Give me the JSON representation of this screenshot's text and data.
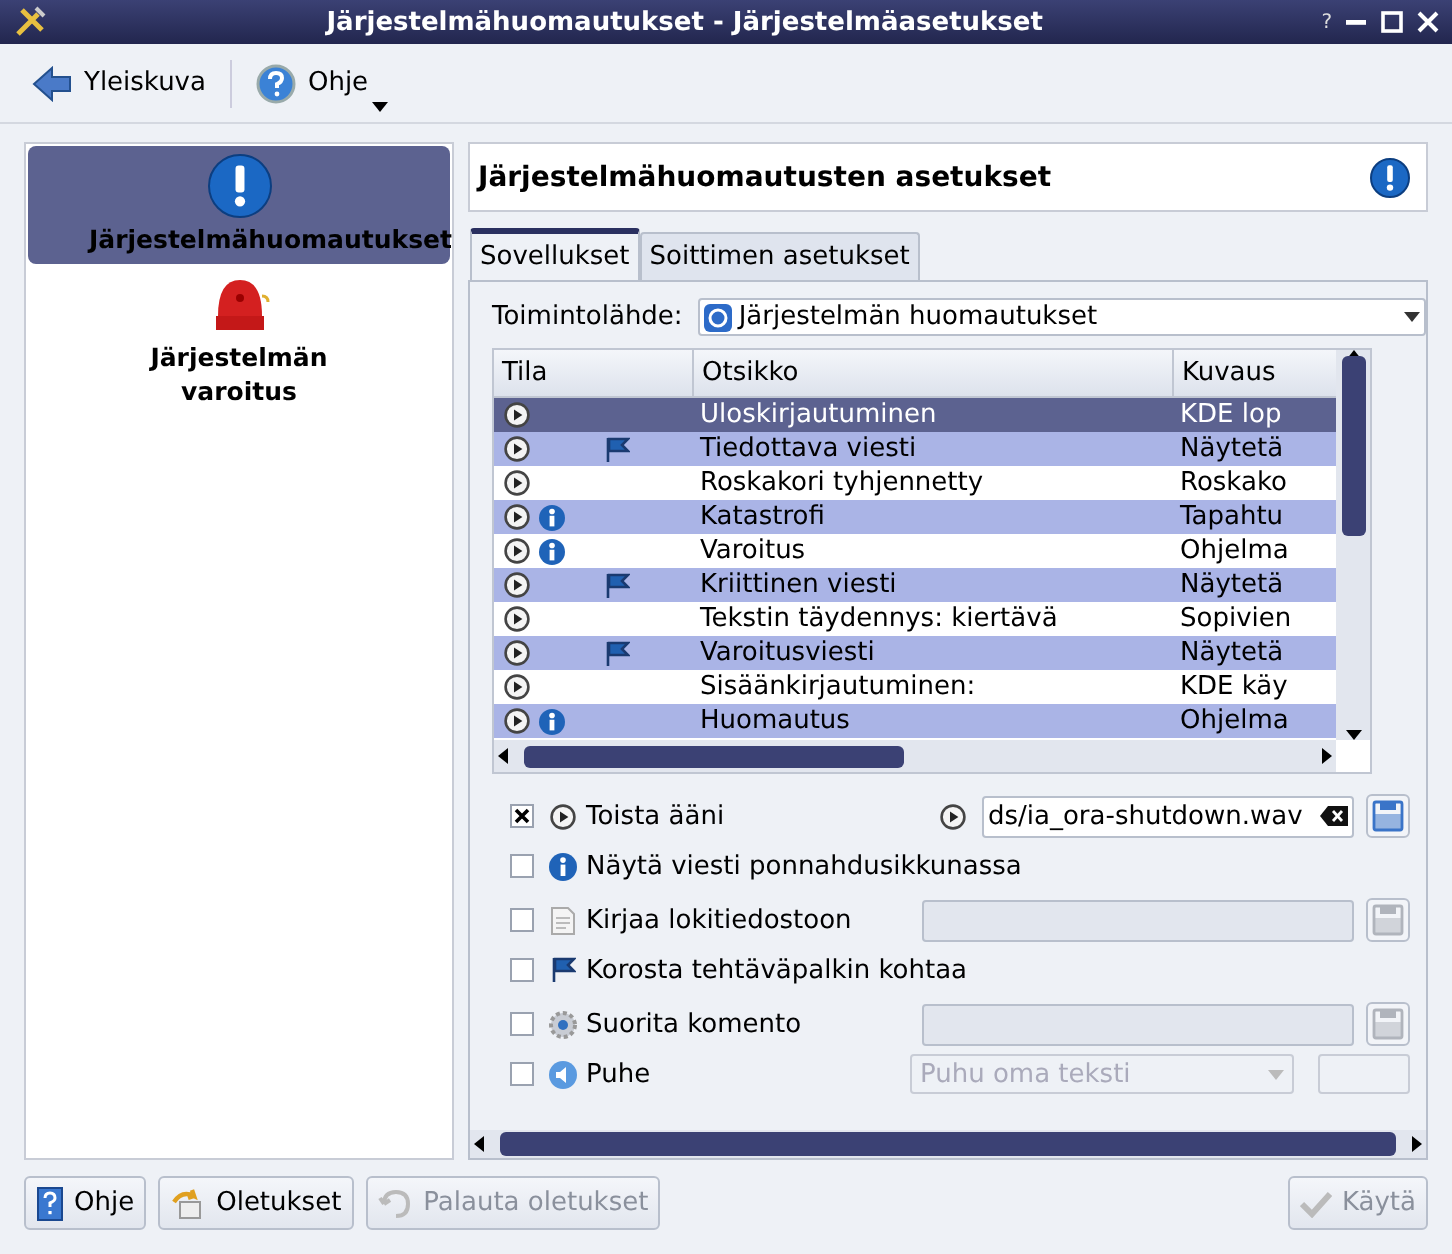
{
  "window": {
    "title": "Järjestelmähuomautukset - Järjestelmäasetukset",
    "help": "?"
  },
  "toolbar": [
    {
      "label": "Yleiskuva",
      "kind": "back",
      "menu": false
    },
    {
      "label": "Ohje",
      "kind": "help",
      "menu": true
    }
  ],
  "sidebar": {
    "items": [
      {
        "label": "Järjestelmähuomautukset",
        "kind": "notify",
        "selected": true
      },
      {
        "label": "Järjestelmän varoitus",
        "kind": "bell",
        "selected": false
      }
    ]
  },
  "header": {
    "title": "Järjestelmähuomautusten asetukset"
  },
  "tabs": [
    {
      "label": "Sovellukset",
      "selected": true
    },
    {
      "label": "Soittimen asetukset",
      "selected": false
    }
  ],
  "source": {
    "label": "Toimintolähde:",
    "value": "Järjestelmän huomautukset"
  },
  "table": {
    "columns": [
      "Tila",
      "Otsikko",
      "Kuvaus"
    ],
    "rows": [
      {
        "sound": true,
        "popup": false,
        "taskbar": false,
        "title": "Uloskirjautuminen",
        "description": "KDE lop",
        "selected": true
      },
      {
        "sound": true,
        "popup": false,
        "taskbar": true,
        "title": "Tiedottava viesti",
        "description": "Näytetä",
        "selected": false
      },
      {
        "sound": true,
        "popup": false,
        "taskbar": false,
        "title": "Roskakori tyhjennetty",
        "description": "Roskako",
        "selected": false
      },
      {
        "sound": true,
        "popup": true,
        "taskbar": false,
        "title": "Katastrofi",
        "description": "Tapahtu",
        "selected": false
      },
      {
        "sound": true,
        "popup": true,
        "taskbar": false,
        "title": "Varoitus",
        "description": "Ohjelma",
        "selected": false
      },
      {
        "sound": true,
        "popup": false,
        "taskbar": true,
        "title": "Kriittinen viesti",
        "description": "Näytetä",
        "selected": false
      },
      {
        "sound": true,
        "popup": false,
        "taskbar": false,
        "title": "Tekstin täydennys: kiertävä",
        "description": "Sopivien",
        "selected": false
      },
      {
        "sound": true,
        "popup": false,
        "taskbar": true,
        "title": "Varoitusviesti",
        "description": "Näytetä",
        "selected": false
      },
      {
        "sound": true,
        "popup": false,
        "taskbar": false,
        "title": "Sisäänkirjautuminen:",
        "description": "KDE käy",
        "selected": false
      },
      {
        "sound": true,
        "popup": true,
        "taskbar": false,
        "title": "Huomautus",
        "description": "Ohjelma",
        "selected": false
      }
    ]
  },
  "actions": [
    {
      "kind": "sound",
      "label": "Toista ääni",
      "checked": true,
      "value": "ds/ia_ora-shutdown.wav"
    },
    {
      "kind": "popup",
      "label": "Näytä viesti ponnahdusikkunassa",
      "checked": false
    },
    {
      "kind": "log",
      "label": "Kirjaa lokitiedostoon",
      "checked": false
    },
    {
      "kind": "taskbar",
      "label": "Korosta tehtäväpalkin kohtaa",
      "checked": false
    },
    {
      "kind": "command",
      "label": "Suorita komento",
      "checked": false
    },
    {
      "kind": "speech",
      "label": "Puhe",
      "checked": false,
      "value": "Puhu oma teksti"
    }
  ],
  "buttons": [
    {
      "label": "Ohje",
      "kind": "help",
      "disabled": false
    },
    {
      "label": "Oletukset",
      "kind": "defaults",
      "disabled": false
    },
    {
      "label": "Palauta oletukset",
      "kind": "reset",
      "disabled": true
    },
    {
      "label": "Käytä",
      "kind": "apply",
      "disabled": true
    }
  ]
}
